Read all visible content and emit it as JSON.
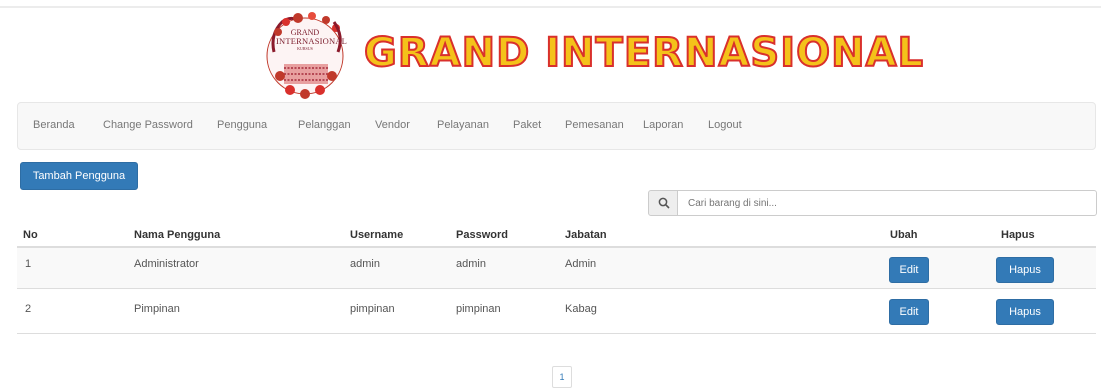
{
  "header": {
    "logo_line1": "GRAND",
    "logo_line2": "INTERNASIONAL",
    "logo_line3": "KURSUS",
    "title": "GRAND INTERNASIONAL"
  },
  "nav": {
    "items": [
      "Beranda",
      "Change Password",
      "Pengguna",
      "Pelanggan",
      "Vendor",
      "Pelayanan",
      "Paket",
      "Pemesanan",
      "Laporan",
      "Logout"
    ]
  },
  "toolbar": {
    "add_label": "Tambah Pengguna"
  },
  "search": {
    "placeholder": "Cari barang di sini..."
  },
  "table": {
    "columns": [
      "No",
      "Nama Pengguna",
      "Username",
      "Password",
      "Jabatan",
      "Ubah",
      "Hapus"
    ],
    "rows": [
      {
        "no": "1",
        "nama": "Administrator",
        "username": "admin",
        "password": "admin",
        "jabatan": "Admin",
        "edit": "Edit",
        "hapus": "Hapus"
      },
      {
        "no": "2",
        "nama": "Pimpinan",
        "username": "pimpinan",
        "password": "pimpinan",
        "jabatan": "Kabag",
        "edit": "Edit",
        "hapus": "Hapus"
      }
    ]
  },
  "pagination": {
    "current": "1"
  },
  "colors": {
    "primary": "#337ab7",
    "brand_fill": "#f4c21a",
    "brand_stroke": "#d9302c",
    "logo": "#c0392b"
  },
  "icons": {
    "search": "search-icon",
    "logo": "logo-icon"
  }
}
